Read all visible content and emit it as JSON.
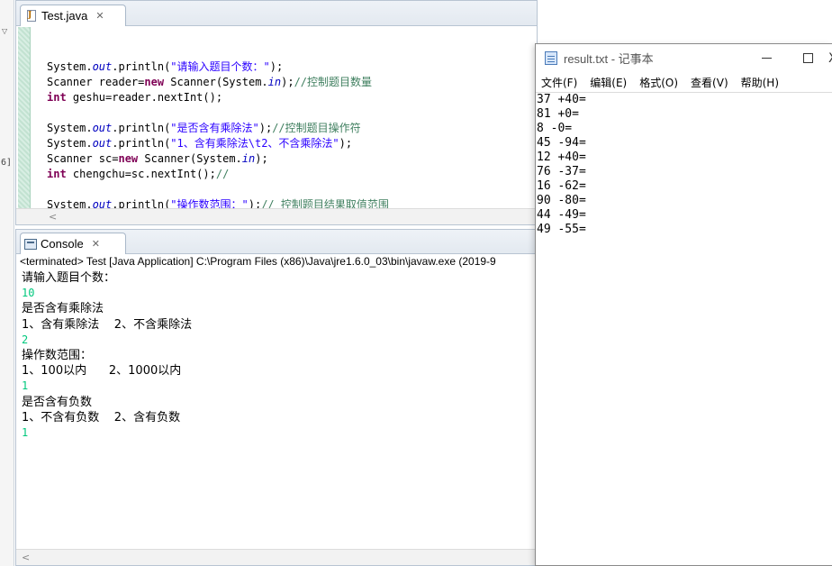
{
  "left_strip": {
    "marker": "6]"
  },
  "editor": {
    "tab_label": "Test.java",
    "lines": [
      [
        {
          "t": "System.",
          "c": ""
        },
        {
          "t": "out",
          "c": "fld"
        },
        {
          "t": ".println(",
          "c": ""
        },
        {
          "t": "\"请输入题目个数：\"",
          "c": "str"
        },
        {
          "t": ");",
          "c": ""
        }
      ],
      [
        {
          "t": "Scanner reader=",
          "c": ""
        },
        {
          "t": "new",
          "c": "kw"
        },
        {
          "t": " Scanner(System.",
          "c": ""
        },
        {
          "t": "in",
          "c": "fld"
        },
        {
          "t": ");",
          "c": ""
        },
        {
          "t": "//控制题目数量",
          "c": "cmt"
        }
      ],
      [
        {
          "t": "int",
          "c": "kw"
        },
        {
          "t": " geshu=reader.nextInt();",
          "c": ""
        }
      ],
      [],
      [
        {
          "t": "System.",
          "c": ""
        },
        {
          "t": "out",
          "c": "fld"
        },
        {
          "t": ".println(",
          "c": ""
        },
        {
          "t": "\"是否含有乘除法\"",
          "c": "str"
        },
        {
          "t": ");",
          "c": ""
        },
        {
          "t": "//控制题目操作符",
          "c": "cmt"
        }
      ],
      [
        {
          "t": "System.",
          "c": ""
        },
        {
          "t": "out",
          "c": "fld"
        },
        {
          "t": ".println(",
          "c": ""
        },
        {
          "t": "\"1、含有乘除法\\t2、不含乘除法\"",
          "c": "str"
        },
        {
          "t": ");",
          "c": ""
        }
      ],
      [
        {
          "t": "Scanner sc=",
          "c": ""
        },
        {
          "t": "new",
          "c": "kw"
        },
        {
          "t": " Scanner(System.",
          "c": ""
        },
        {
          "t": "in",
          "c": "fld"
        },
        {
          "t": ");",
          "c": ""
        }
      ],
      [
        {
          "t": "int",
          "c": "kw"
        },
        {
          "t": " chengchu=sc.nextInt();",
          "c": ""
        },
        {
          "t": "//",
          "c": "cmt"
        }
      ],
      [],
      [
        {
          "t": "System.",
          "c": ""
        },
        {
          "t": "out",
          "c": "fld"
        },
        {
          "t": ".println(",
          "c": ""
        },
        {
          "t": "\"操作数范围：\"",
          "c": "str"
        },
        {
          "t": ");",
          "c": ""
        },
        {
          "t": "// 控制题目结果取值范围",
          "c": "cmt"
        }
      ]
    ]
  },
  "console": {
    "tab_label": "Console",
    "header": "<terminated> Test [Java Application] C:\\Program Files (x86)\\Java\\jre1.6.0_03\\bin\\javaw.exe (2019-9",
    "lines": [
      {
        "text": "请输入题目个数：",
        "input": false
      },
      {
        "text": "10",
        "input": true
      },
      {
        "text": "是否含有乘除法",
        "input": false
      },
      {
        "text": "1、含有乘除法    2、不含乘除法",
        "input": false
      },
      {
        "text": "2",
        "input": true
      },
      {
        "text": "操作数范围：",
        "input": false
      },
      {
        "text": "1、100以内      2、1000以内",
        "input": false
      },
      {
        "text": "1",
        "input": true
      },
      {
        "text": "是否含有负数",
        "input": false
      },
      {
        "text": "1、不含有负数    2、含有负数",
        "input": false
      },
      {
        "text": "1",
        "input": true
      }
    ]
  },
  "notepad": {
    "title": "result.txt - 记事本",
    "menus": [
      "文件(F)",
      "编辑(E)",
      "格式(O)",
      "查看(V)",
      "帮助(H)"
    ],
    "close_glyph": "X",
    "lines": [
      "37 +40=",
      "81 +0=",
      "8 -0=",
      "45 -94=",
      "12 +40=",
      "76 -37=",
      "16 -62=",
      "90 -80=",
      "44 -49=",
      "49 -55="
    ]
  }
}
